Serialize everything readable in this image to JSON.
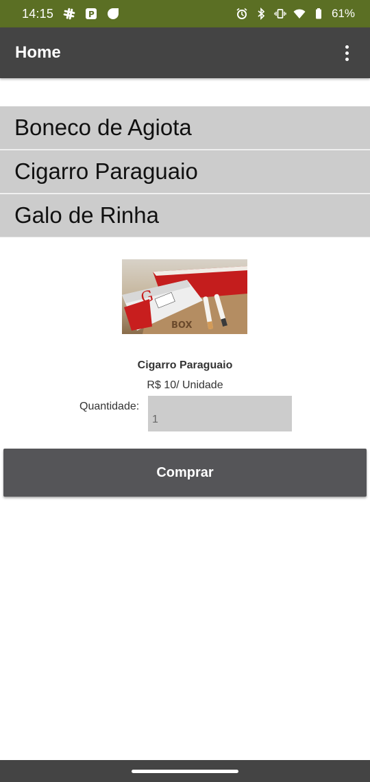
{
  "status_bar": {
    "time": "14:15",
    "battery": "61%",
    "background_color": "#5b6f24",
    "icons_left": [
      "slack-icon",
      "parking-icon",
      "circle-notification-icon"
    ],
    "icons_right": [
      "alarm-icon",
      "bluetooth-icon",
      "vibrate-icon",
      "wifi-icon",
      "battery-icon"
    ]
  },
  "app_bar": {
    "title": "Home",
    "background_color": "#444444",
    "overflow_icon": "more-vert-icon"
  },
  "products": [
    {
      "label": "Boneco de Agiota"
    },
    {
      "label": "Cigarro Paraguaio"
    },
    {
      "label": "Galo de Rinha"
    }
  ],
  "detail": {
    "name": "Cigarro Paraguaio",
    "price": "R$ 10/ Unidade",
    "quantity_label": "Quantidade:",
    "quantity_value": "1"
  },
  "buy_button": {
    "label": "Comprar",
    "background_color": "#555558"
  }
}
